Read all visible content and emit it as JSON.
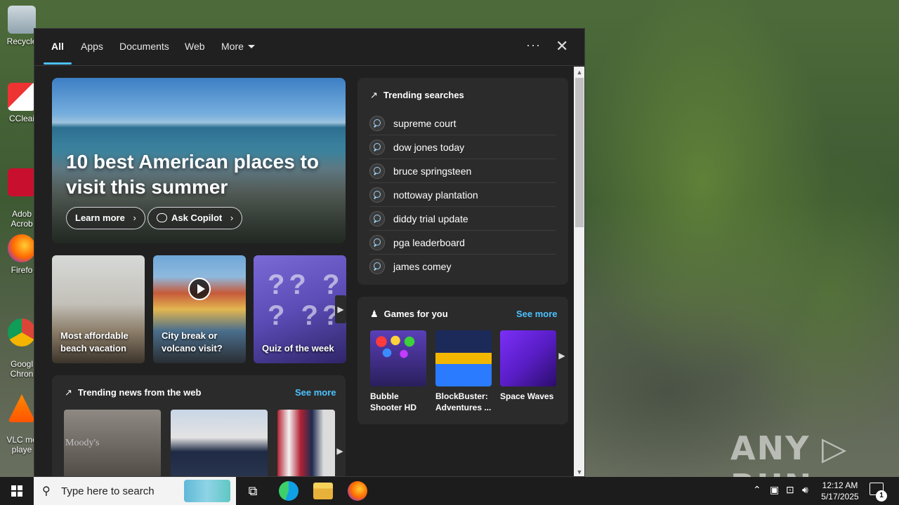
{
  "desktop": {
    "icons": [
      {
        "label": "Recycle",
        "icon": "recycle-bin-icon"
      },
      {
        "label": "CCleaner",
        "icon": "ccleaner-icon"
      },
      {
        "label": "Adobe Acrobat",
        "icon": "acrobat-icon"
      },
      {
        "label": "Firefox",
        "icon": "firefox-icon"
      },
      {
        "label": "Google Chrome",
        "icon": "chrome-icon"
      },
      {
        "label": "VLC media player",
        "icon": "vlc-icon"
      }
    ],
    "icon_labels_visible": [
      "Recycle",
      "CCleai",
      "Adob\nAcrob",
      "Firefo",
      "Googl\nChron",
      "VLC me\nplaye"
    ]
  },
  "watermark": {
    "left": "ANY",
    "right": "RUN"
  },
  "search_panel": {
    "tabs": [
      {
        "label": "All",
        "active": true
      },
      {
        "label": "Apps"
      },
      {
        "label": "Documents"
      },
      {
        "label": "Web"
      },
      {
        "label": "More"
      }
    ],
    "options_label": "···",
    "close_label": "✕",
    "hero": {
      "title": "10 best American places to visit this summer",
      "learn_more": "Learn more",
      "ask_copilot": "Ask Copilot"
    },
    "cards": [
      {
        "label": "Most affordable beach vacation"
      },
      {
        "label": "City break or volcano visit?"
      },
      {
        "label": "Quiz of the week"
      }
    ],
    "trending_searches": {
      "title": "Trending searches",
      "items": [
        "supreme court",
        "dow jones today",
        "bruce springsteen",
        "nottoway plantation",
        "diddy trial update",
        "pga leaderboard",
        "james comey"
      ]
    },
    "games": {
      "title": "Games for you",
      "see_more": "See more",
      "items": [
        {
          "label": "Bubble Shooter HD"
        },
        {
          "label": "BlockBuster: Adventures ..."
        },
        {
          "label": "Space Waves"
        }
      ]
    },
    "trending_news": {
      "title": "Trending news from the web",
      "see_more": "See more",
      "image_caption": "Moody's"
    }
  },
  "taskbar": {
    "search_placeholder": "Type here to search",
    "time": "12:12 AM",
    "date": "5/17/2025",
    "notification_count": "1"
  },
  "colors": {
    "accent": "#4cc2ff",
    "panel_bg": "#202020",
    "card_bg": "#2b2b2b"
  }
}
